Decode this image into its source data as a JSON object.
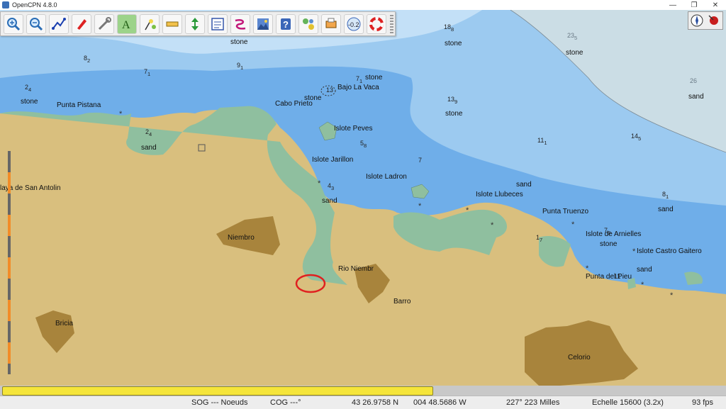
{
  "window": {
    "title": "OpenCPN 4.8.0"
  },
  "colors": {
    "land": "#d9bf7e",
    "shallow_green": "#8fbf9f",
    "water_blue": "#6faee9",
    "medium_blue": "#9ccaf0",
    "deep": "#cbdde5",
    "built_up": "#a8843c",
    "progress": "#f5e53a",
    "highlight_ring": "#e02020"
  },
  "toolbar": {
    "buttons": [
      {
        "name": "zoom-in-icon"
      },
      {
        "name": "zoom-out-icon"
      },
      {
        "name": "route-icon"
      },
      {
        "name": "ship-icon"
      },
      {
        "name": "tools-icon"
      },
      {
        "name": "text-tool-icon"
      },
      {
        "name": "tide-icon"
      },
      {
        "name": "measure-icon"
      },
      {
        "name": "arrows-icon"
      },
      {
        "name": "chart-settings-icon"
      },
      {
        "name": "track-icon"
      },
      {
        "name": "layers-icon"
      },
      {
        "name": "help-icon"
      },
      {
        "name": "ais-icon"
      },
      {
        "name": "print-icon"
      },
      {
        "name": "tide-readout-icon",
        "text": "-0.2"
      },
      {
        "name": "mob-icon"
      }
    ]
  },
  "places": [
    {
      "id": "punta-pistana",
      "text": "Punta Pistana"
    },
    {
      "id": "cabo-prieto",
      "text": "Cabo Prieto"
    },
    {
      "id": "bajo-la-vaca",
      "text": "Bajo La Vaca"
    },
    {
      "id": "islote-peves",
      "text": "Islote Peves"
    },
    {
      "id": "islote-jarillon",
      "text": "Islote Jarillon"
    },
    {
      "id": "islote-ladron",
      "text": "Islote Ladron"
    },
    {
      "id": "islote-llubeces",
      "text": "Islote Llubeces"
    },
    {
      "id": "punta-truenzo",
      "text": "Punta Truenzo"
    },
    {
      "id": "islote-arnielles",
      "text": "Islote de Arnielles"
    },
    {
      "id": "islote-castro-gaitero",
      "text": "Islote Castro Gaitero"
    },
    {
      "id": "punta-del-pieu",
      "text": "Punta del Pieu"
    },
    {
      "id": "playa-san-antolin",
      "text": "laya de San Antolin"
    },
    {
      "id": "niembro",
      "text": "Niembro"
    },
    {
      "id": "rio-niembro",
      "text": "Rio Niembr"
    },
    {
      "id": "barro",
      "text": "Barro"
    },
    {
      "id": "bricia",
      "text": "Bricia"
    },
    {
      "id": "celorio",
      "text": "Celorio"
    }
  ],
  "seabed": [
    {
      "id": "stone-1",
      "text": "stone"
    },
    {
      "id": "stone-2",
      "text": "stone"
    },
    {
      "id": "stone-3",
      "text": "stone"
    },
    {
      "id": "stone-4",
      "text": "stone"
    },
    {
      "id": "stone-5",
      "text": "stone"
    },
    {
      "id": "stone-6",
      "text": "stone"
    },
    {
      "id": "stone-7",
      "text": "stone"
    },
    {
      "id": "stone-8",
      "text": "stone"
    },
    {
      "id": "sand-1",
      "text": "sand"
    },
    {
      "id": "sand-2",
      "text": "sand"
    },
    {
      "id": "sand-3",
      "text": "sand"
    },
    {
      "id": "sand-4",
      "text": "sand"
    },
    {
      "id": "sand-5",
      "text": "sand"
    },
    {
      "id": "sand-6",
      "text": "sand"
    }
  ],
  "soundings": [
    {
      "id": "s1",
      "text": "8",
      "sub": "2"
    },
    {
      "id": "s2",
      "text": "7",
      "sub": "1"
    },
    {
      "id": "s3",
      "text": "9",
      "sub": "1"
    },
    {
      "id": "s4",
      "text": "2",
      "sub": "4"
    },
    {
      "id": "s5",
      "text": "18",
      "sub": "8"
    },
    {
      "id": "s6",
      "text": "7",
      "sub": "1"
    },
    {
      "id": "s7",
      "text": "13",
      "sub": "9"
    },
    {
      "id": "s8",
      "text": "2",
      "sub": "4"
    },
    {
      "id": "s9",
      "text": "5",
      "sub": "8"
    },
    {
      "id": "s10",
      "text": "7",
      "sub": ""
    },
    {
      "id": "s11",
      "text": "4",
      "sub": "3"
    },
    {
      "id": "s12",
      "text": "11",
      "sub": "1"
    },
    {
      "id": "s13",
      "text": "14",
      "sub": "5"
    },
    {
      "id": "s14",
      "text": "8",
      "sub": "1"
    },
    {
      "id": "s15",
      "text": "7",
      "sub": "9"
    },
    {
      "id": "s16",
      "text": "1",
      "sub": "7"
    },
    {
      "id": "s17",
      "text": "11",
      "sub": ""
    },
    {
      "id": "s18",
      "text": "23",
      "sub": "5"
    },
    {
      "id": "s19",
      "text": "26",
      "sub": ""
    },
    {
      "id": "s20",
      "text": "13",
      "sub": ""
    }
  ],
  "progress": {
    "fraction": 0.595
  },
  "status": {
    "sog": "SOG --- Noeuds",
    "cog": "COG ---°",
    "lat": "43 26.9758 N",
    "lon": "004 48.5686 W",
    "bearing_distance": "227°  223 Milles",
    "scale": "Echelle 15600 (3.2x)",
    "fps": "93 fps"
  }
}
